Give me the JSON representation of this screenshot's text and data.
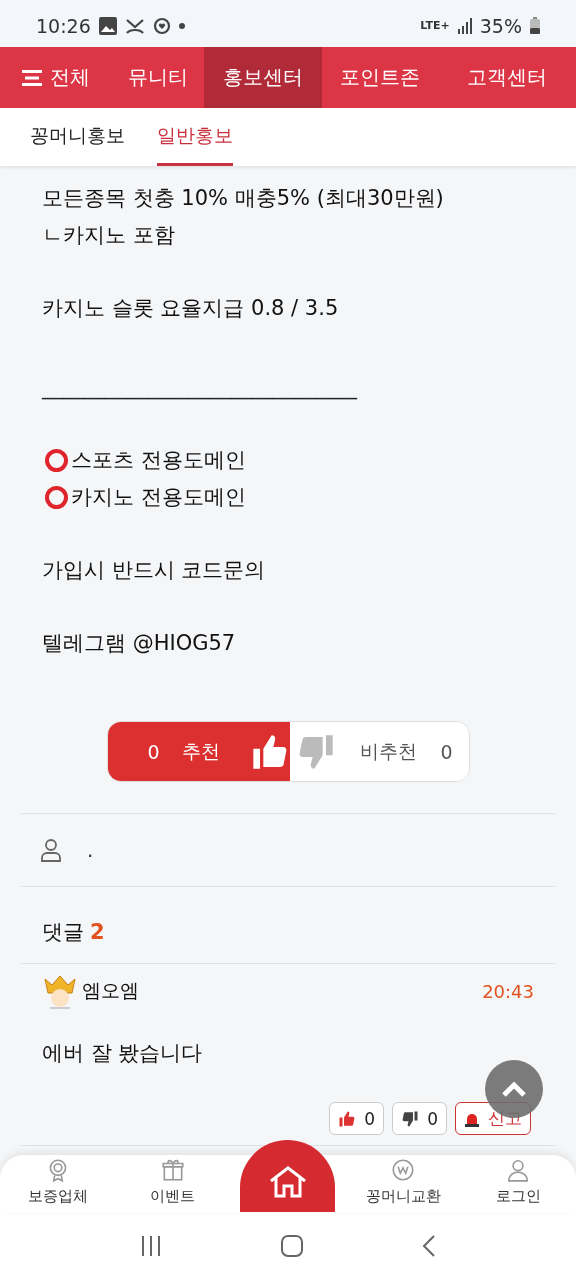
{
  "status_bar": {
    "time": "10:26",
    "network": "LTE+",
    "battery": "35%"
  },
  "nav": {
    "menu_label": "전체",
    "items": [
      {
        "label": "뮤니티",
        "selected": false
      },
      {
        "label": "홍보센터",
        "selected": true
      },
      {
        "label": "포인트존",
        "selected": false
      },
      {
        "label": "고객센터",
        "selected": false
      }
    ]
  },
  "sub_tabs": [
    {
      "label": "꽁머니홍보",
      "selected": false
    },
    {
      "label": "일반홍보",
      "selected": true
    }
  ],
  "post": {
    "paragraphs": [
      [
        {
          "text": "모든종목 첫충 10% 매충5% (최대30만원)",
          "kind": "plain"
        },
        {
          "text": "ㄴ카지노 포함",
          "kind": "plain"
        }
      ],
      [
        {
          "text": "카지노 슬롯 요율지급 0.8 / 3.5",
          "kind": "plain"
        }
      ],
      [
        {
          "text": "______________________________",
          "kind": "rule"
        }
      ],
      [
        {
          "text": "스포츠 전용도메인",
          "kind": "ring"
        },
        {
          "text": "카지노 전용도메인",
          "kind": "ring"
        }
      ],
      [
        {
          "text": "가입시 반드시 코드문의",
          "kind": "plain"
        }
      ],
      [
        {
          "text": "텔레그램 @HIOG57",
          "kind": "plain"
        }
      ]
    ]
  },
  "vote": {
    "up_count": "0",
    "up_label": "추천",
    "down_label": "비추천",
    "down_count": "0"
  },
  "author": {
    "name": "."
  },
  "comments": {
    "title": "댓글",
    "count": "2",
    "items": [
      {
        "name": "엠오엠",
        "time": "20:43",
        "text": "에버 잘 봤습니다",
        "likes": "0",
        "dislikes": "0",
        "report": "신고"
      }
    ]
  },
  "bottom_nav": [
    {
      "label": "보증업체",
      "kind": "medal"
    },
    {
      "label": "이벤트",
      "kind": "gift"
    },
    {
      "kind": "home"
    },
    {
      "label": "꽁머니교환",
      "kind": "coin"
    },
    {
      "label": "로그인",
      "kind": "user"
    }
  ]
}
